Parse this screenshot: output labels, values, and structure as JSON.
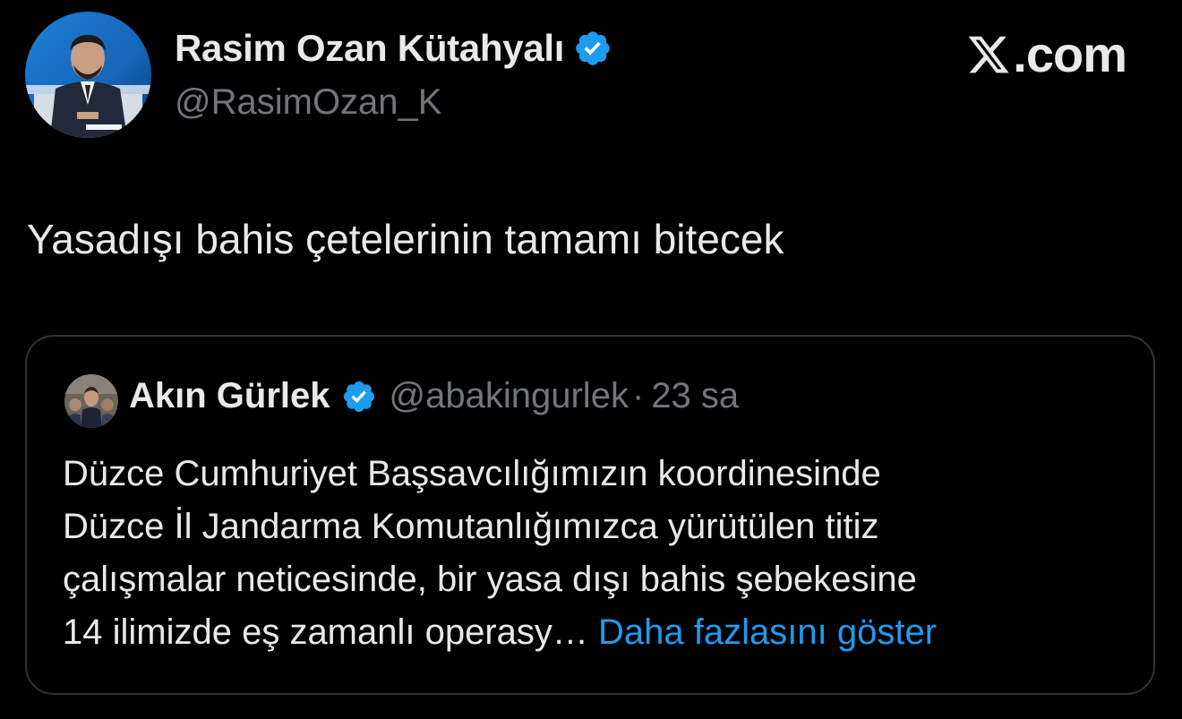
{
  "author": {
    "name": "Rasim Ozan Kütahyalı",
    "handle": "@RasimOzan_K",
    "verified_icon": "verified-badge-icon"
  },
  "brand": {
    "label": ".com",
    "logo": "x-logo-icon"
  },
  "tweet": {
    "text": "Yasadışı bahis çetelerinin tamamı bitecek"
  },
  "quoted_tweet": {
    "author_name": "Akın Gürlek",
    "handle": "@abakingurlek",
    "separator": "·",
    "time": "23 sa",
    "text_lines": [
      "Düzce Cumhuriyet Başsavcılığımızın koordinesinde",
      "Düzce İl Jandarma Komutanlığımızca yürütülen titiz",
      "çalışmalar neticesinde, bir yasa dışı bahis şebekesine",
      "14 ilimizde eş zamanlı operasy…"
    ],
    "show_more": "Daha fazlasını göster"
  },
  "colors": {
    "background": "#000000",
    "text_primary": "#e7e9ea",
    "text_secondary": "#71767b",
    "accent_link": "#1d9bf0",
    "verified_badge": "#1d9bf0",
    "card_border": "#2f3336"
  }
}
